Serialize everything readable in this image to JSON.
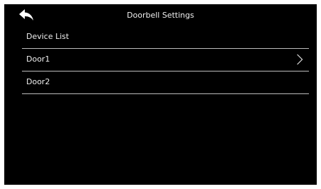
{
  "header": {
    "title": "Doorbell Settings",
    "back_icon": "back-arrow-icon"
  },
  "device_list": {
    "label": "Device List",
    "items": [
      {
        "label": "Door1",
        "icon": "chevron-right-icon"
      },
      {
        "label": "Door2"
      }
    ]
  },
  "colors": {
    "background": "#000000",
    "text": "#f0f0f0",
    "divider": "#bdbdbd"
  }
}
